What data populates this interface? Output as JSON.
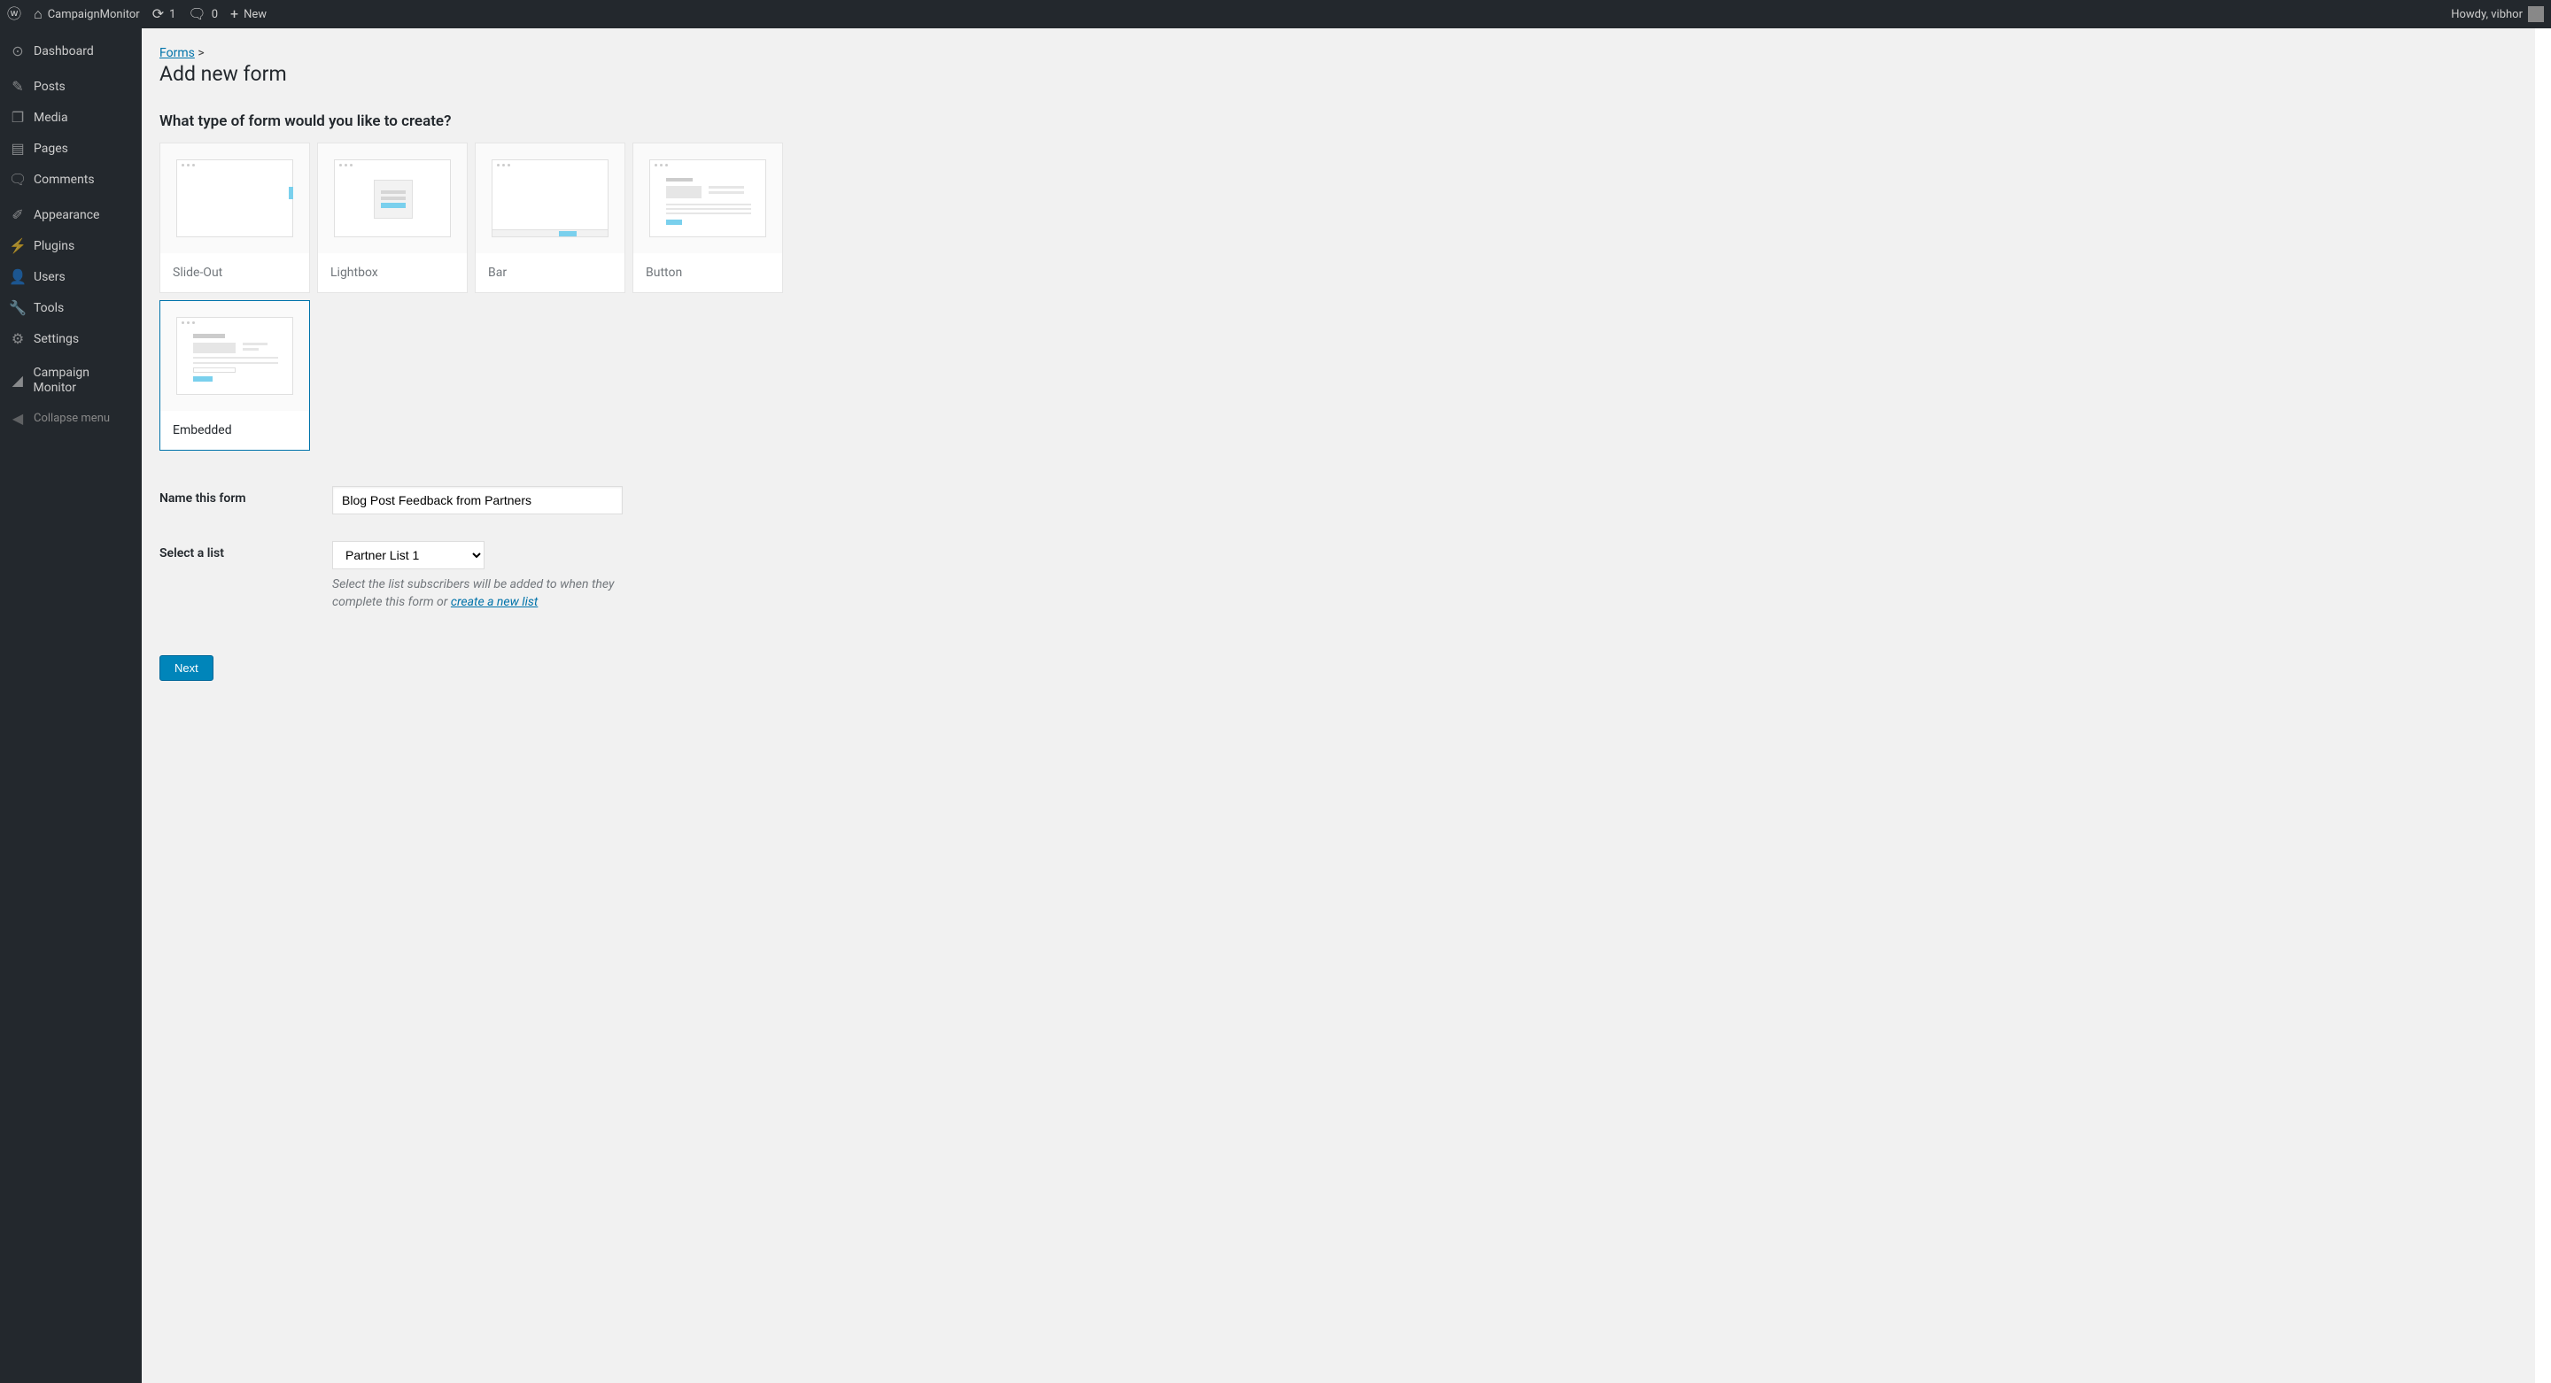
{
  "adminbar": {
    "site_name": "CampaignMonitor",
    "updates_count": "1",
    "comments_count": "0",
    "new_label": "New",
    "greeting": "Howdy, vibhor"
  },
  "sidebar": {
    "items": [
      {
        "icon": "🏠",
        "label": "Dashboard"
      },
      {
        "icon": "📌",
        "label": "Posts"
      },
      {
        "icon": "🖼",
        "label": "Media"
      },
      {
        "icon": "📄",
        "label": "Pages"
      },
      {
        "icon": "💬",
        "label": "Comments"
      },
      {
        "icon": "🎨",
        "label": "Appearance"
      },
      {
        "icon": "🔌",
        "label": "Plugins"
      },
      {
        "icon": "👤",
        "label": "Users"
      },
      {
        "icon": "🔧",
        "label": "Tools"
      },
      {
        "icon": "⚙",
        "label": "Settings"
      },
      {
        "icon": "📊",
        "label": "Campaign Monitor"
      }
    ],
    "collapse": "Collapse menu"
  },
  "breadcrumb": {
    "parent": "Forms",
    "separator": ">"
  },
  "page_title": "Add new form",
  "section_title": "What type of form would you like to create?",
  "form_types": [
    {
      "label": "Slide-Out",
      "selected": false
    },
    {
      "label": "Lightbox",
      "selected": false
    },
    {
      "label": "Bar",
      "selected": false
    },
    {
      "label": "Button",
      "selected": false
    },
    {
      "label": "Embedded",
      "selected": true
    }
  ],
  "fields": {
    "name": {
      "label": "Name this form",
      "value": "Blog Post Feedback from Partners"
    },
    "list": {
      "label": "Select a list",
      "value": "Partner List 1",
      "help_pre": "Select the list subscribers will be added to when they complete this form or ",
      "help_link": "create a new list"
    }
  },
  "next_button": "Next"
}
